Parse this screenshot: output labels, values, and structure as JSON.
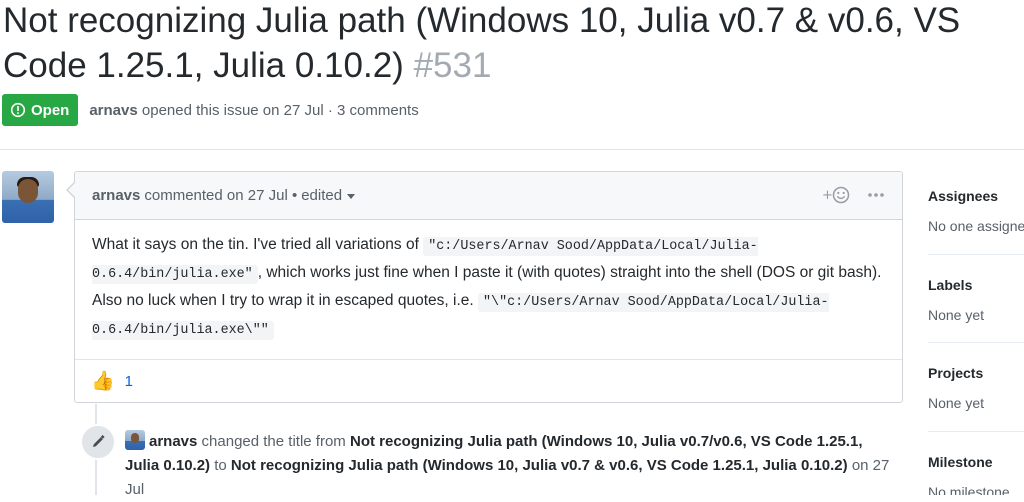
{
  "issue": {
    "title": "Not recognizing Julia path (Windows 10, Julia v0.7 & v0.6, VS Code 1.25.1, Julia 0.10.2)",
    "number": "#531",
    "state": "Open",
    "author": "arnavs",
    "opened_text": "opened this issue on 27 Jul · 3 comments"
  },
  "comment": {
    "author": "arnavs",
    "commented_text": "commented on 27 Jul •",
    "edited_label": "edited",
    "body_1": "What it says on the tin. I've tried all variations of",
    "code_1": "\"c:/Users/Arnav Sood/AppData/Local/Julia-0.6.4/bin/julia.exe\"",
    "body_2": ", which works just fine when I paste it (with quotes) straight into the shell (DOS or git bash). Also no luck when I try to wrap it in escaped quotes, i.e.",
    "code_2": "\"\\\"c:/Users/Arnav Sood/AppData/Local/Julia-0.6.4/bin/julia.exe\\\"\"",
    "reaction_count": "1",
    "add_reaction_icon": "smiley-plus-icon",
    "more_icon": "kebab-horizontal-icon"
  },
  "event": {
    "actor": "arnavs",
    "changed_text": "changed the title from",
    "old_title": "Not recognizing Julia path (Windows 10, Julia v0.7/v0.6, VS Code 1.25.1, Julia 0.10.2)",
    "to_text": "to",
    "new_title": "Not recognizing Julia path (Windows 10, Julia v0.7 & v0.6, VS Code 1.25.1, Julia 0.10.2)",
    "date_text": "on 27 Jul",
    "icon": "pencil-icon"
  },
  "sidebar": {
    "assignees_label": "Assignees",
    "assignees_value": "No one assigned",
    "labels_label": "Labels",
    "labels_value": "None yet",
    "projects_label": "Projects",
    "projects_value": "None yet",
    "milestone_label": "Milestone",
    "milestone_value": "No milestone"
  },
  "colors": {
    "open_green": "#28a745",
    "link_blue": "#0366d6",
    "muted_text": "#586069",
    "issue_number_gray": "#a3aab1"
  }
}
